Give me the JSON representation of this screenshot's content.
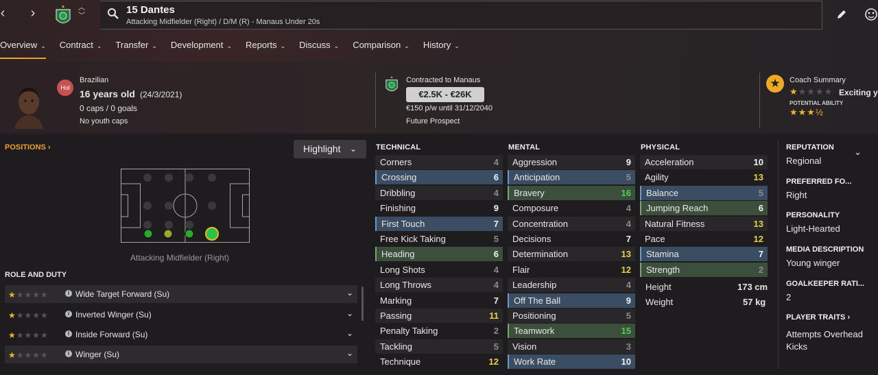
{
  "header": {
    "player_name": "15 Dantes",
    "subtitle": "Attacking Midfielder (Right) / D/M (R) - Manaus Under 20s"
  },
  "tabs": [
    {
      "label": "Overview",
      "active": true
    },
    {
      "label": "Contract"
    },
    {
      "label": "Transfer"
    },
    {
      "label": "Development"
    },
    {
      "label": "Reports"
    },
    {
      "label": "Discuss"
    },
    {
      "label": "Comparison"
    },
    {
      "label": "History"
    }
  ],
  "profile": {
    "nationality": "Brazilian",
    "badge": "Hol",
    "age": "16 years old",
    "dob": "(24/3/2021)",
    "caps": "0 caps / 0 goals",
    "youth_caps": "No youth caps"
  },
  "contract": {
    "club": "Contracted to Manaus",
    "value_range": "€2.5K - €26K",
    "wage": "€150 p/w until 31/12/2040",
    "status": "Future Prospect"
  },
  "coach": {
    "title": "Coach Summary",
    "summary": "Exciting y",
    "current_stars": 1,
    "potential_label": "POTENTIAL ABILITY",
    "potential_stars": 3.5
  },
  "positions": {
    "header": "POSITIONS",
    "highlight_label": "Highlight",
    "position_caption": "Attacking Midfielder (Right)"
  },
  "roles": {
    "header": "ROLE AND DUTY",
    "items": [
      {
        "name": "Wide Target Forward (Su)",
        "stars": 1
      },
      {
        "name": "Inverted Winger (Su)",
        "stars": 1
      },
      {
        "name": "Inside Forward (Su)",
        "stars": 1
      },
      {
        "name": "Winger (Su)",
        "stars": 1
      }
    ]
  },
  "attributes": {
    "technical": {
      "header": "TECHNICAL",
      "rows": [
        {
          "name": "Corners",
          "value": "4",
          "hl": ""
        },
        {
          "name": "Crossing",
          "value": "6",
          "hl": "blue"
        },
        {
          "name": "Dribbling",
          "value": "4",
          "hl": ""
        },
        {
          "name": "Finishing",
          "value": "9",
          "hl": ""
        },
        {
          "name": "First Touch",
          "value": "7",
          "hl": "blue"
        },
        {
          "name": "Free Kick Taking",
          "value": "5",
          "hl": ""
        },
        {
          "name": "Heading",
          "value": "6",
          "hl": "green"
        },
        {
          "name": "Long Shots",
          "value": "4",
          "hl": ""
        },
        {
          "name": "Long Throws",
          "value": "4",
          "hl": ""
        },
        {
          "name": "Marking",
          "value": "7",
          "hl": ""
        },
        {
          "name": "Passing",
          "value": "11",
          "hl": ""
        },
        {
          "name": "Penalty Taking",
          "value": "2",
          "hl": ""
        },
        {
          "name": "Tackling",
          "value": "5",
          "hl": ""
        },
        {
          "name": "Technique",
          "value": "12",
          "hl": ""
        }
      ]
    },
    "mental": {
      "header": "MENTAL",
      "rows": [
        {
          "name": "Aggression",
          "value": "9",
          "hl": ""
        },
        {
          "name": "Anticipation",
          "value": "5",
          "hl": "blue"
        },
        {
          "name": "Bravery",
          "value": "16",
          "hl": "green"
        },
        {
          "name": "Composure",
          "value": "4",
          "hl": ""
        },
        {
          "name": "Concentration",
          "value": "4",
          "hl": ""
        },
        {
          "name": "Decisions",
          "value": "7",
          "hl": ""
        },
        {
          "name": "Determination",
          "value": "13",
          "hl": ""
        },
        {
          "name": "Flair",
          "value": "12",
          "hl": ""
        },
        {
          "name": "Leadership",
          "value": "4",
          "hl": ""
        },
        {
          "name": "Off The Ball",
          "value": "9",
          "hl": "blue"
        },
        {
          "name": "Positioning",
          "value": "5",
          "hl": ""
        },
        {
          "name": "Teamwork",
          "value": "15",
          "hl": "green"
        },
        {
          "name": "Vision",
          "value": "3",
          "hl": ""
        },
        {
          "name": "Work Rate",
          "value": "10",
          "hl": "blue"
        }
      ]
    },
    "physical": {
      "header": "PHYSICAL",
      "rows": [
        {
          "name": "Acceleration",
          "value": "10",
          "hl": ""
        },
        {
          "name": "Agility",
          "value": "13",
          "hl": ""
        },
        {
          "name": "Balance",
          "value": "5",
          "hl": "blue"
        },
        {
          "name": "Jumping Reach",
          "value": "6",
          "hl": "green"
        },
        {
          "name": "Natural Fitness",
          "value": "13",
          "hl": ""
        },
        {
          "name": "Pace",
          "value": "12",
          "hl": ""
        },
        {
          "name": "Stamina",
          "value": "7",
          "hl": "blue"
        },
        {
          "name": "Strength",
          "value": "2",
          "hl": "green"
        }
      ],
      "height_label": "Height",
      "height": "173 cm",
      "weight_label": "Weight",
      "weight": "57 kg"
    }
  },
  "side": {
    "reputation_label": "REPUTATION",
    "reputation": "Regional",
    "foot_label": "PREFERRED FO...",
    "foot": "Right",
    "personality_label": "PERSONALITY",
    "personality": "Light-Hearted",
    "media_label": "MEDIA DESCRIPTION",
    "media": "Young winger",
    "gk_label": "GOALKEEPER RATI...",
    "gk": "2",
    "traits_label": "PLAYER TRAITS",
    "traits": "Attempts Overhead Kicks"
  },
  "colors": {
    "accent": "#f0a028",
    "value_yellow": "#e6d24a",
    "value_green": "#4fd24f",
    "value_white": "#f2f2f2",
    "value_grey": "#8a8a8a",
    "highlight_blue": "#3a4d62",
    "highlight_green": "#3c4e3c"
  }
}
